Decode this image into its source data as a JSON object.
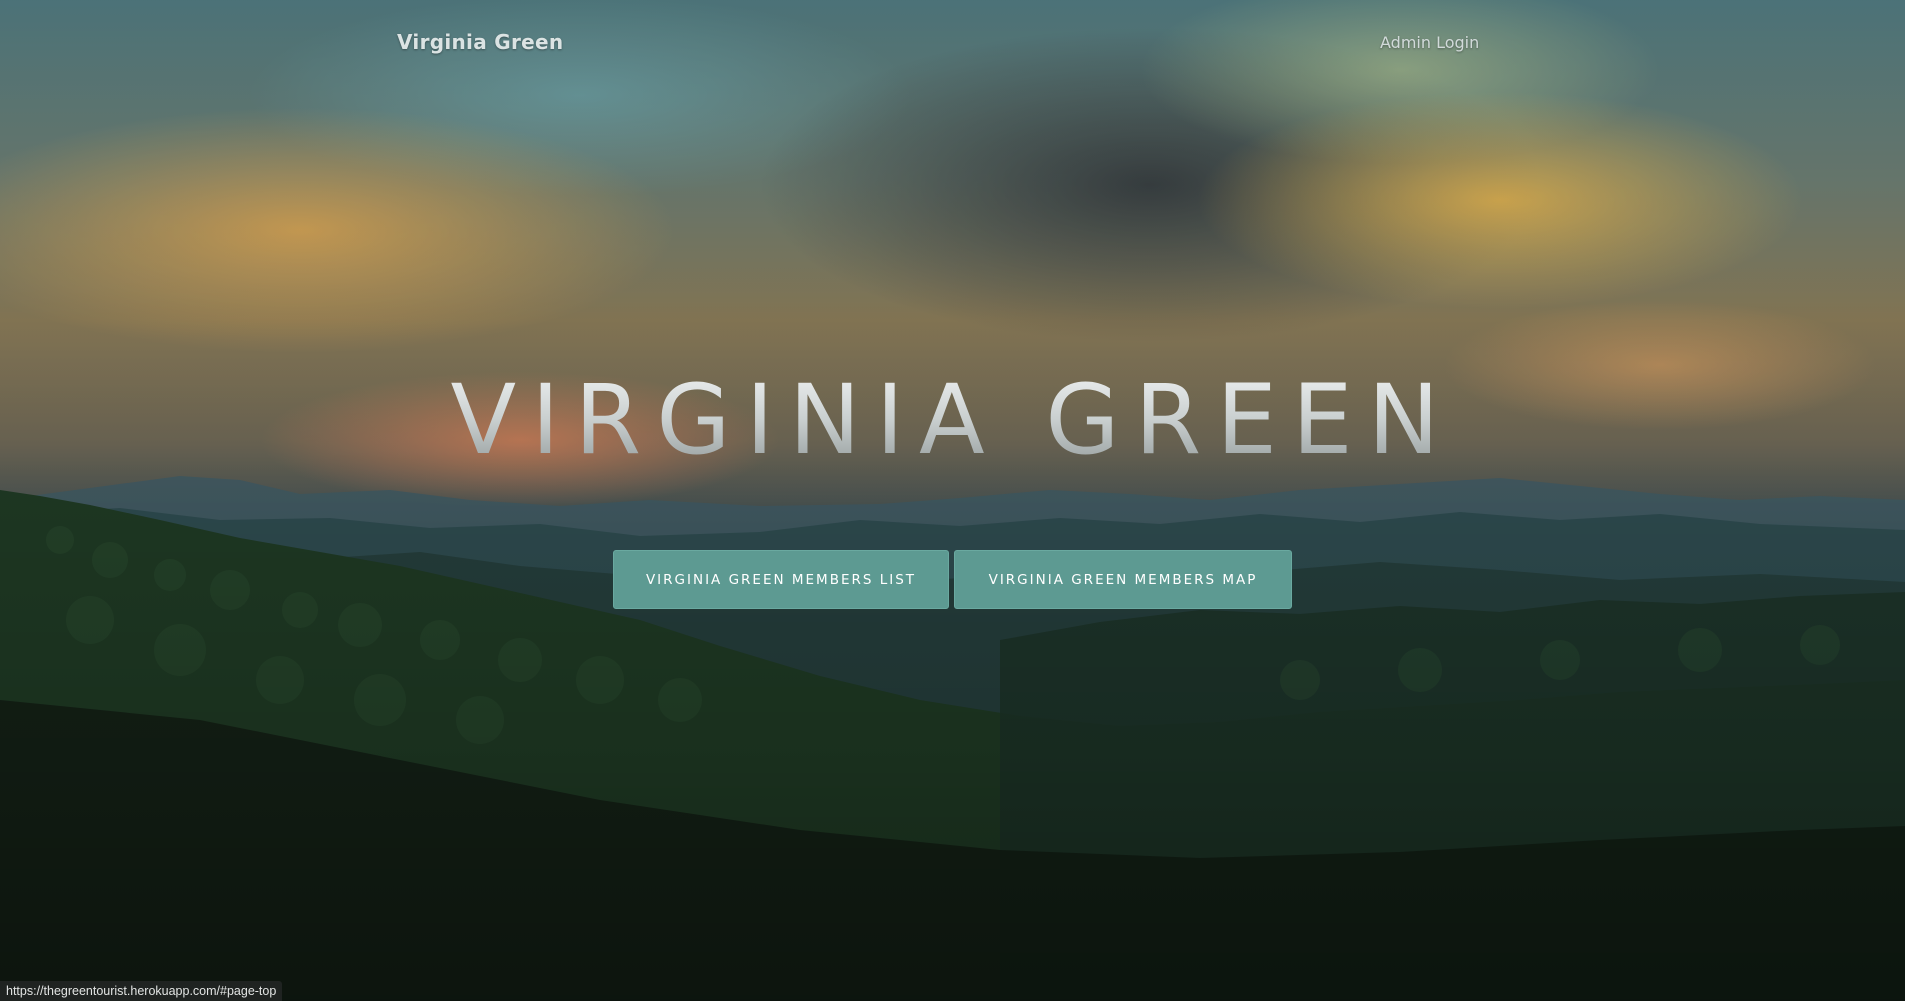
{
  "navbar": {
    "brand": "Virginia Green",
    "admin_login": "Admin Login"
  },
  "hero": {
    "title": "VIRGINIA GREEN",
    "buttons": {
      "members_list": "VIRGINIA GREEN MEMBERS LIST",
      "members_map": "VIRGINIA GREEN MEMBERS MAP"
    }
  },
  "status_bar": {
    "url": "https://thegreentourist.herokuapp.com/#page-top"
  },
  "colors": {
    "button_background": "#5d9a92",
    "button_text": "#ffffff",
    "nav_text": "#dbe3e3"
  }
}
